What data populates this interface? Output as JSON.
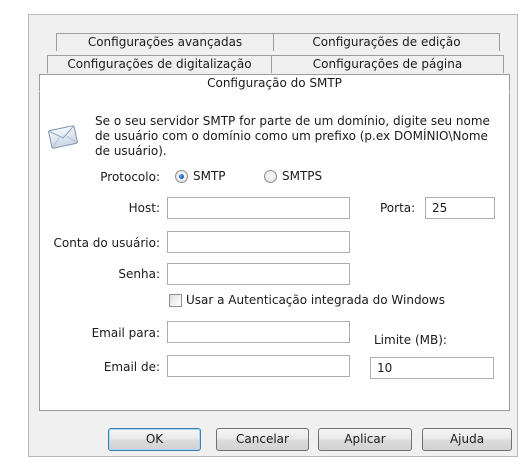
{
  "tabs_row1": [
    {
      "label": "Configurações avançadas"
    },
    {
      "label": "Configurações de edição"
    }
  ],
  "tabs_row2": [
    {
      "label": "Configurações de digitalização"
    },
    {
      "label": "Configurações de página"
    }
  ],
  "active_tab": {
    "label": "Configuração do SMTP"
  },
  "info": {
    "line1": "Se o seu servidor SMTP for parte de um domínio, digite seu nome",
    "line2": "de usuário com o domínio como um prefixo (p.ex DOMÍNIO\\Nome",
    "line3": "de usuário)."
  },
  "protocol": {
    "label": "Protocolo:",
    "options": [
      {
        "label": "SMTP",
        "selected": true
      },
      {
        "label": "SMTPS",
        "selected": false
      }
    ]
  },
  "form": {
    "host_label": "Host:",
    "host_value": "",
    "port_label": "Porta:",
    "port_value": "25",
    "account_label": "Conta do usuário:",
    "account_value": "",
    "password_label": "Senha:",
    "password_value": "",
    "integrated_auth_label": "Usar a Autenticação integrada do Windows",
    "integrated_auth_checked": false,
    "email_to_label": "Email para:",
    "email_to_value": "",
    "limit_label": "Limite (MB):",
    "limit_value": "10",
    "email_from_label": "Email de:",
    "email_from_value": ""
  },
  "buttons": {
    "ok": "OK",
    "cancel": "Cancelar",
    "apply": "Aplicar",
    "help": "Ajuda"
  },
  "icons": {
    "mail": "mail-envelope-icon"
  }
}
